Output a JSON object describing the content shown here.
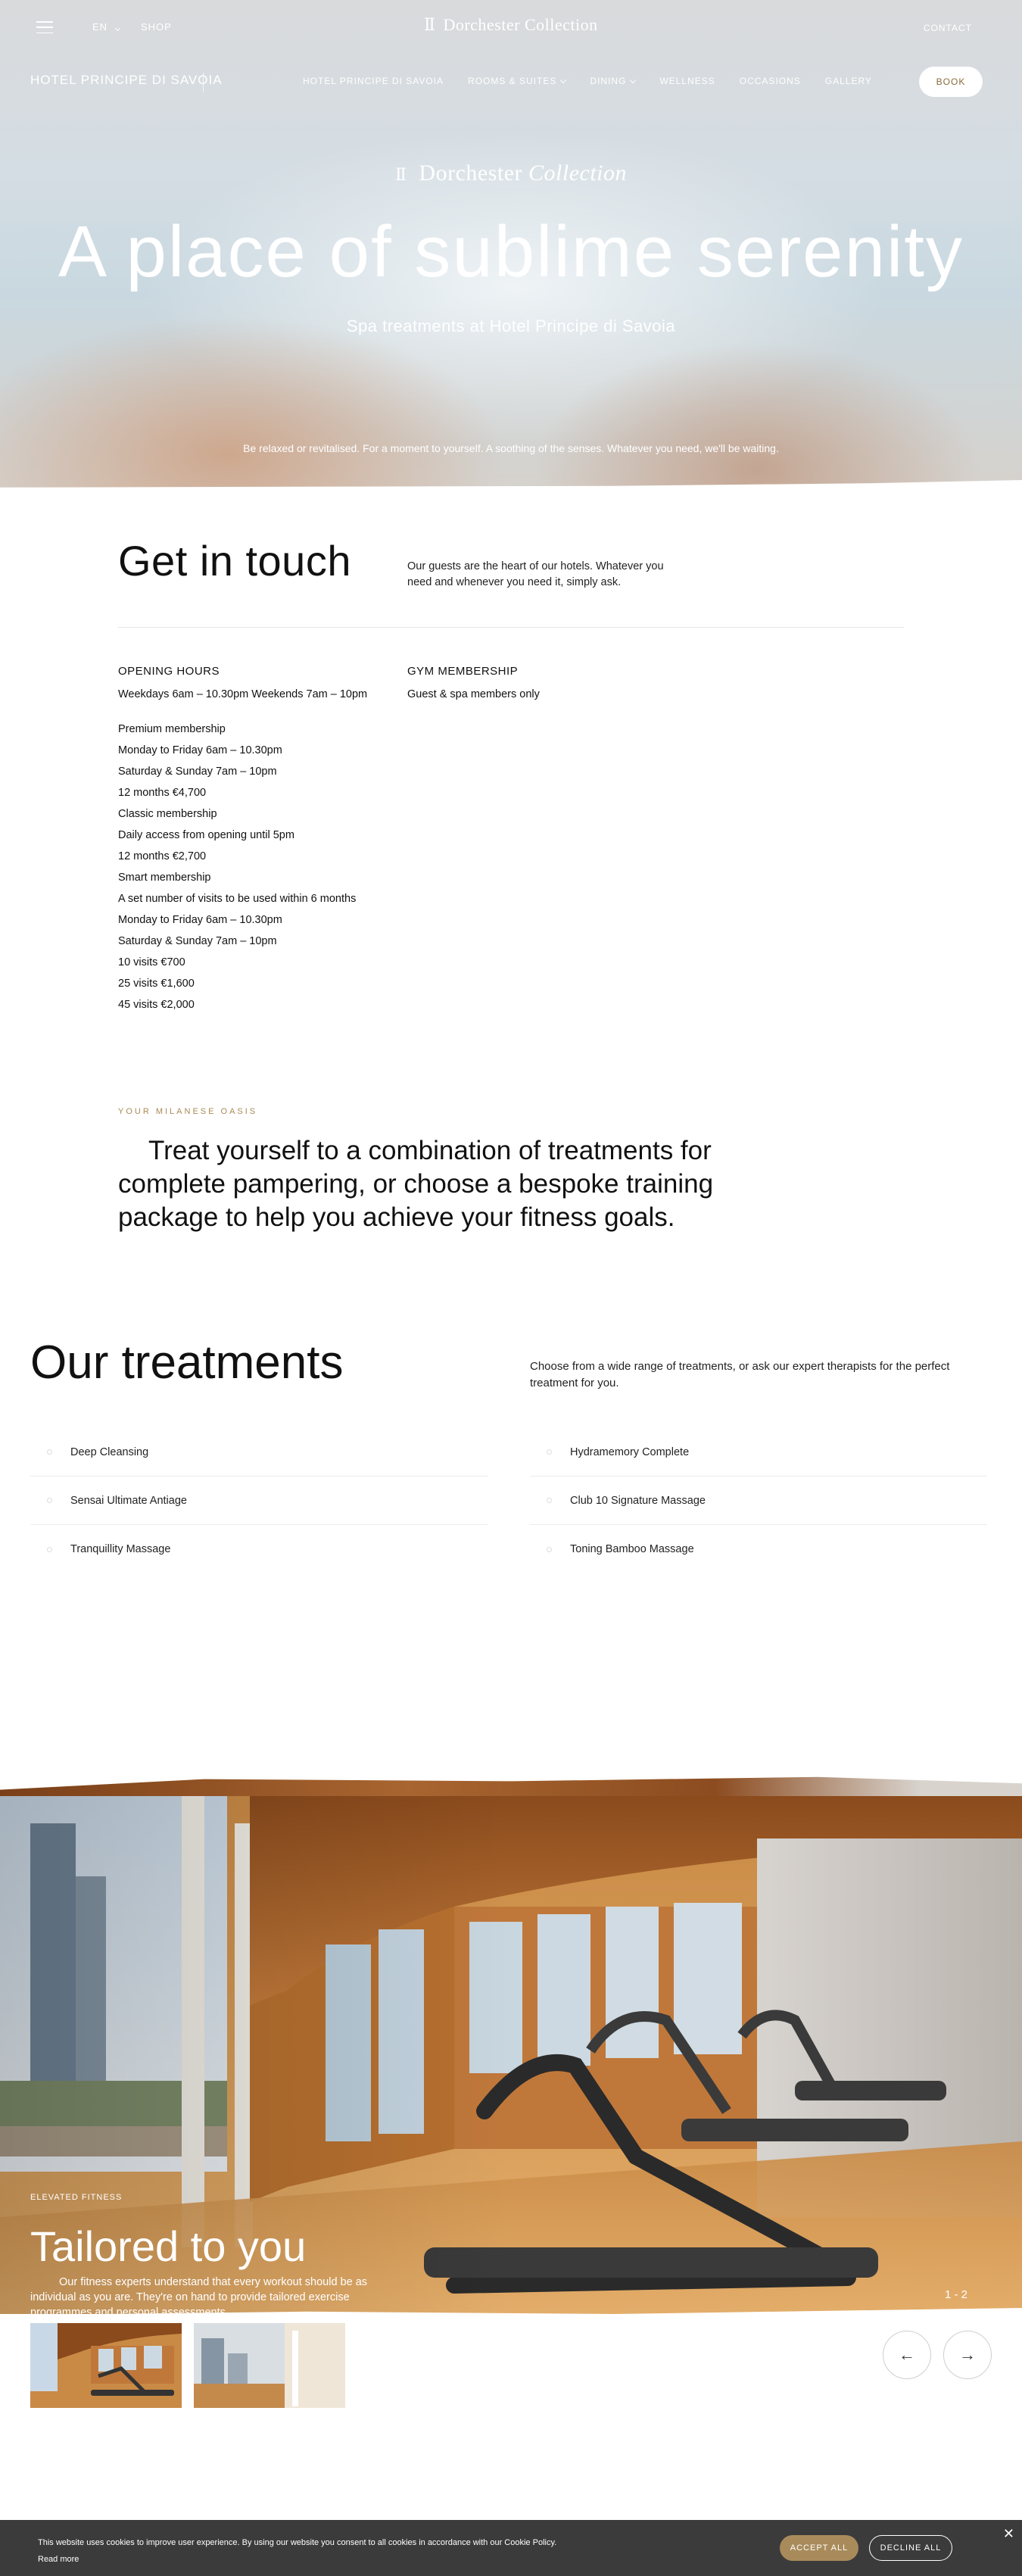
{
  "header": {
    "lang": "EN",
    "shop": "SHOP",
    "logo": "Dorchester Collection",
    "contact": "CONTACT"
  },
  "nav": {
    "hotel_name": "HOTEL PRINCIPE DI SAVOIA",
    "items": [
      {
        "label": "HOTEL PRINCIPE DI SAVOIA",
        "dropdown": false
      },
      {
        "label": "ROOMS & SUITES",
        "dropdown": true
      },
      {
        "label": "DINING",
        "dropdown": true
      },
      {
        "label": "WELLNESS",
        "dropdown": false
      },
      {
        "label": "OCCASIONS",
        "dropdown": false
      },
      {
        "label": "GALLERY",
        "dropdown": false
      }
    ],
    "book": "BOOK"
  },
  "hero": {
    "logo_main": "Dorchester",
    "logo_italic": "Collection",
    "title": "A place of sublime serenity",
    "subtitle": "Spa treatments at Hotel Principe di Savoia",
    "description": "Be relaxed or revitalised. For a moment to yourself. A soothing of the senses. Whatever you need, we'll be waiting."
  },
  "contact_section": {
    "title": "Get in touch",
    "intro": "Our guests are the heart of our hotels. Whatever you need and whenever you need it, simply ask.",
    "opening_hours": {
      "heading": "OPENING HOURS",
      "first": "Weekdays 6am – 10.30pm Weekends 7am – 10pm",
      "lines": [
        "Premium membership",
        "Monday to Friday 6am – 10.30pm",
        "Saturday & Sunday 7am – 10pm",
        "12 months €4,700",
        "Classic membership",
        "Daily access from opening until 5pm",
        "12 months €2,700",
        "Smart membership",
        "A set number of visits to be used within 6 months",
        "Monday to Friday 6am – 10.30pm",
        "Saturday & Sunday 7am – 10pm",
        "10 visits €700",
        "25 visits €1,600",
        "45 visits €2,000"
      ]
    },
    "gym": {
      "heading": "GYM MEMBERSHIP",
      "text": "Guest & spa members only"
    }
  },
  "oasis": {
    "eyebrow": "YOUR MILANESE OASIS",
    "text": "Treat yourself to a combination of treatments for complete pampering, or choose a bespoke training package to help you achieve your fitness goals."
  },
  "treatments": {
    "title": "Our treatments",
    "intro": "Choose from a wide range of treatments, or ask our expert therapists for the perfect treatment for you.",
    "left": [
      "Deep Cleansing",
      "Sensai Ultimate Antiage",
      "Tranquillity Massage"
    ],
    "right": [
      "Hydramemory Complete",
      "Club 10 Signature Massage",
      "Toning Bamboo Massage"
    ]
  },
  "gallery": {
    "eyebrow": "ELEVATED FITNESS",
    "title": "Tailored to you",
    "text": "Our fitness experts understand that every workout should be as individual as you are. They're on hand to provide tailored exercise programmes and personal assessments.",
    "counter": "1 - 2",
    "prev_icon": "arrow-left-icon",
    "next_icon": "arrow-right-icon"
  },
  "cookie": {
    "text": "This website uses cookies to improve user experience. By using our website you consent to all cookies in accordance with our Cookie Policy.",
    "read_more": "Read more",
    "accept": "ACCEPT ALL",
    "decline": "DECLINE ALL"
  },
  "colors": {
    "accent_gold": "#a98b5b",
    "cookie_bg": "#3b3b3b"
  }
}
